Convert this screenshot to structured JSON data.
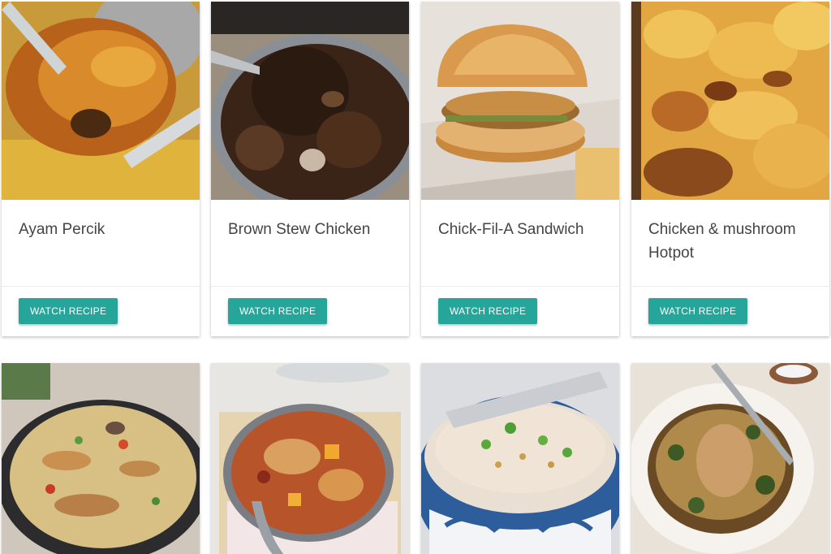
{
  "recipes": [
    {
      "title": "Ayam Percik",
      "action_label": "WATCH RECIPE"
    },
    {
      "title": "Brown Stew Chicken",
      "action_label": "WATCH RECIPE"
    },
    {
      "title": "Chick-Fil-A Sandwich",
      "action_label": "WATCH RECIPE"
    },
    {
      "title": "Chicken & mushroom Hotpot",
      "action_label": "WATCH RECIPE"
    },
    {
      "title": "",
      "action_label": ""
    },
    {
      "title": "",
      "action_label": ""
    },
    {
      "title": "",
      "action_label": ""
    },
    {
      "title": "",
      "action_label": ""
    }
  ],
  "colors": {
    "accent": "#26a69a",
    "title_text": "#444444",
    "background": "#ffffff"
  }
}
